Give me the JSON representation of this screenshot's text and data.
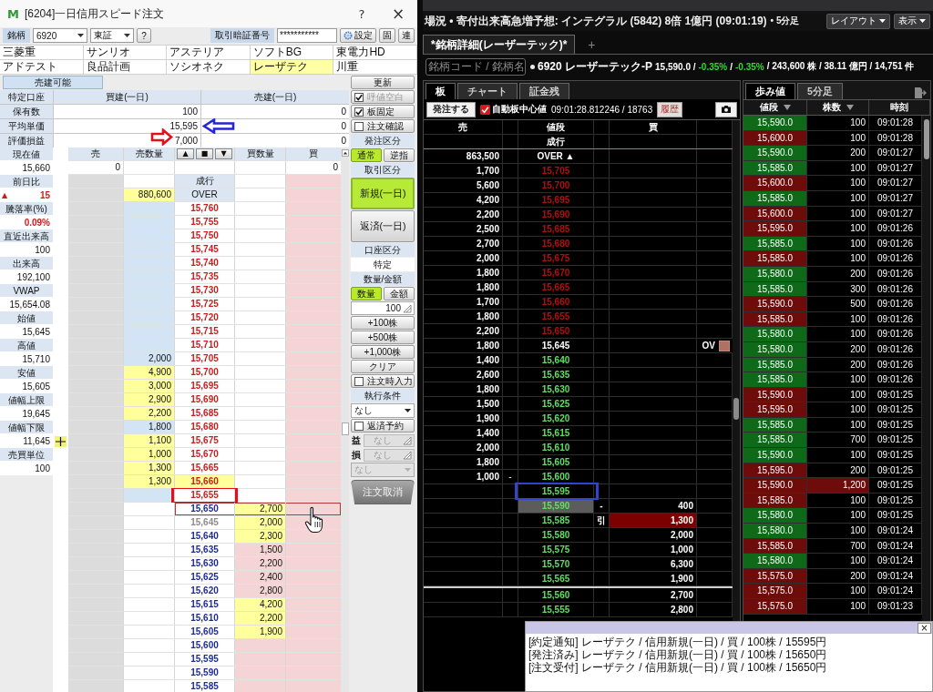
{
  "left_window": {
    "logo": "M",
    "title": "[6204]一日信用スピード注文",
    "title_buttons": [
      {
        "kind": "help",
        "label": "?"
      },
      {
        "kind": "close",
        "label": "×"
      }
    ],
    "symbol_label": "銘柄",
    "symbol_code": "6920",
    "market": "東証",
    "symbol_help": "?",
    "pin_label": "取引暗証番号",
    "pin_value": "***********",
    "tool_buttons": [
      {
        "kind": "settings",
        "label": "設定"
      },
      {
        "kind": "plain",
        "label": "固"
      },
      {
        "kind": "plain",
        "label": "連"
      }
    ],
    "favorites": [
      {
        "label": "三菱重",
        "selected": false
      },
      {
        "label": "サンリオ",
        "selected": false
      },
      {
        "label": "アステリア",
        "selected": false
      },
      {
        "label": "ソフトBG",
        "selected": false
      },
      {
        "label": "東電力HD",
        "selected": false
      },
      {
        "label": "アドテスト",
        "selected": false
      },
      {
        "label": "良品計画",
        "selected": false
      },
      {
        "label": "ソシオネク",
        "selected": false
      },
      {
        "label": "レーザテク",
        "selected": true
      },
      {
        "label": "川重",
        "selected": false
      }
    ],
    "margin_status": "売建可能",
    "position_table": {
      "columns": [
        "特定口座",
        "買建(一日)",
        "売建(一日)"
      ],
      "rows": [
        {
          "kind": "plain",
          "label": "保有数",
          "buy": "100",
          "sell": "0"
        },
        {
          "kind": "arrow_left",
          "label": "平均単価",
          "buy": "15,595",
          "sell": "0"
        },
        {
          "kind": "arrow_right",
          "label": "評価損益",
          "buy": "7,000",
          "sell": "0"
        }
      ]
    },
    "stats": [
      {
        "label": "現在値",
        "value": "15,660"
      },
      {
        "label": "前日比",
        "value": "15",
        "prefix": "▲",
        "color": "#d01818"
      },
      {
        "label": "騰落率(%)",
        "value": "0.09%",
        "color": "#d01818"
      },
      {
        "label": "直近出来高",
        "value": "100"
      },
      {
        "label": "出来高",
        "value": "192,100"
      },
      {
        "label": "VWAP",
        "value": "15,654.08"
      },
      {
        "label": "始値",
        "value": "15,645"
      },
      {
        "label": "高値",
        "value": "15,710"
      },
      {
        "label": "安値",
        "value": "15,605"
      },
      {
        "label": "値幅上限",
        "value": "19,645"
      },
      {
        "label": "値幅下限",
        "value": "11,645",
        "marker": true
      },
      {
        "label": "売買単位",
        "value": "100"
      }
    ],
    "ladder": {
      "headers": {
        "sell": "売",
        "sell_qty": "売数量",
        "buy_qty": "買数量",
        "buy": "買"
      },
      "nav_buttons": [
        "▲",
        "■",
        "▼"
      ],
      "totals": {
        "sell": "0",
        "buy": "0"
      },
      "market_label": "成行",
      "over": {
        "label": "OVER",
        "sell_qty": "880,600",
        "flash": true
      },
      "rows": [
        {
          "price": "15,760",
          "color": "#c81e1e",
          "ask": true
        },
        {
          "price": "15,755",
          "color": "#c81e1e",
          "ask": true
        },
        {
          "price": "15,750",
          "color": "#c81e1e",
          "ask": true
        },
        {
          "price": "15,745",
          "color": "#c81e1e",
          "ask": true
        },
        {
          "price": "15,740",
          "color": "#c81e1e",
          "ask": true
        },
        {
          "price": "15,735",
          "color": "#c81e1e",
          "ask": true
        },
        {
          "price": "15,730",
          "color": "#c81e1e",
          "ask": true
        },
        {
          "price": "15,725",
          "color": "#c81e1e",
          "ask": true
        },
        {
          "price": "15,720",
          "color": "#c81e1e",
          "ask": true
        },
        {
          "price": "15,715",
          "color": "#c81e1e",
          "ask": true
        },
        {
          "price": "15,710",
          "color": "#c81e1e",
          "ask": true
        },
        {
          "price": "15,705",
          "color": "#c81e1e",
          "ask": true,
          "sell_qty": "2,000",
          "flash": false
        },
        {
          "price": "15,700",
          "color": "#c81e1e",
          "ask": true,
          "sell_qty": "4,900",
          "flash": true
        },
        {
          "price": "15,695",
          "color": "#c81e1e",
          "ask": true,
          "sell_qty": "3,000",
          "flash": true
        },
        {
          "price": "15,690",
          "color": "#c81e1e",
          "ask": true,
          "sell_qty": "2,900",
          "flash": true
        },
        {
          "price": "15,685",
          "color": "#c81e1e",
          "ask": true,
          "sell_qty": "2,200",
          "flash": true
        },
        {
          "price": "15,680",
          "color": "#c81e1e",
          "ask": true,
          "sell_qty": "1,800",
          "flash": false
        },
        {
          "price": "15,675",
          "color": "#c81e1e",
          "ask": true,
          "sell_qty": "1,100",
          "flash": true
        },
        {
          "price": "15,670",
          "color": "#c81e1e",
          "ask": true,
          "sell_qty": "1,000",
          "flash": true
        },
        {
          "price": "15,665",
          "color": "#c81e1e",
          "ask": true,
          "sell_qty": "1,300",
          "flash": true
        },
        {
          "price": "15,660",
          "color": "#c81e1e",
          "ask": true,
          "sell_qty": "1,300",
          "flash": true,
          "current": true
        },
        {
          "price": "15,655",
          "color": "#c81e1e",
          "ask": true,
          "marked": true
        },
        {
          "price": "15,650",
          "color": "#1e2c9a",
          "ask": false,
          "buy_qty": "2,700",
          "flash": true,
          "hover": true
        },
        {
          "price": "15,645",
          "color": "#8c8c8c",
          "ask": false,
          "buy_qty": "2,000",
          "flash": true
        },
        {
          "price": "15,640",
          "color": "#1e2c9a",
          "ask": false,
          "buy_qty": "2,300",
          "flash": true
        },
        {
          "price": "15,635",
          "color": "#1e2c9a",
          "ask": false,
          "buy_qty": "1,500",
          "flash": false
        },
        {
          "price": "15,630",
          "color": "#1e2c9a",
          "ask": false,
          "buy_qty": "2,200",
          "flash": false
        },
        {
          "price": "15,625",
          "color": "#1e2c9a",
          "ask": false,
          "buy_qty": "2,400",
          "flash": false
        },
        {
          "price": "15,620",
          "color": "#1e2c9a",
          "ask": false,
          "buy_qty": "2,800",
          "flash": false
        },
        {
          "price": "15,615",
          "color": "#1e2c9a",
          "ask": false,
          "buy_qty": "4,200",
          "flash": true
        },
        {
          "price": "15,610",
          "color": "#1e2c9a",
          "ask": false,
          "buy_qty": "2,200",
          "flash": true
        },
        {
          "price": "15,605",
          "color": "#1e2c9a",
          "ask": false,
          "buy_qty": "1,900",
          "flash": true
        },
        {
          "price": "15,600",
          "color": "#1e2c9a",
          "ask": false
        },
        {
          "price": "15,595",
          "color": "#1e2c9a",
          "ask": false
        },
        {
          "price": "15,590",
          "color": "#1e2c9a",
          "ask": false
        },
        {
          "price": "15,585",
          "color": "#1e2c9a",
          "ask": false
        }
      ]
    },
    "side_panel": [
      {
        "kind": "button",
        "label": "更新"
      },
      {
        "kind": "checkbox",
        "label": "呼値空白",
        "checked": true,
        "disabled": true
      },
      {
        "kind": "checkbox",
        "label": "板固定",
        "checked": true,
        "disabled": false
      },
      {
        "kind": "checkbox",
        "label": "注文確認",
        "checked": false,
        "disabled": false
      },
      {
        "kind": "heading",
        "label": "発注区分"
      },
      {
        "kind": "segmented",
        "options": [
          {
            "label": "通常",
            "selected": true
          },
          {
            "label": "逆指",
            "selected": false
          }
        ]
      },
      {
        "kind": "heading",
        "label": "取引区分"
      },
      {
        "kind": "action",
        "label": "新規(一日)",
        "selected": true
      },
      {
        "kind": "action",
        "label": "返済(一日)",
        "selected": false
      },
      {
        "kind": "heading",
        "label": "口座区分"
      },
      {
        "kind": "value",
        "label": "特定"
      },
      {
        "kind": "heading",
        "label": "数量/金額"
      },
      {
        "kind": "segmented",
        "options": [
          {
            "label": "数量",
            "selected": true
          },
          {
            "label": "金額",
            "selected": false
          }
        ]
      },
      {
        "kind": "input",
        "value": "100"
      },
      {
        "kind": "button",
        "label": "+100株"
      },
      {
        "kind": "button",
        "label": "+500株"
      },
      {
        "kind": "button",
        "label": "+1,000株"
      },
      {
        "kind": "button",
        "label": "クリア"
      },
      {
        "kind": "checkbox",
        "label": "注文時入力",
        "checked": false,
        "disabled": false
      },
      {
        "kind": "heading",
        "label": "執行条件"
      },
      {
        "kind": "select",
        "value": "なし",
        "disabled": false
      },
      {
        "kind": "checkbox",
        "label": "返済予約",
        "checked": false,
        "disabled": false
      },
      {
        "kind": "prefixed",
        "prefix": "益",
        "value": "なし",
        "disabled": true
      },
      {
        "kind": "prefixed",
        "prefix": "損",
        "value": "なし",
        "disabled": true
      },
      {
        "kind": "select",
        "value": "なし",
        "disabled": true
      },
      {
        "kind": "cancel",
        "label": "注文取消"
      }
    ]
  },
  "app": {
    "toolbar": {
      "ticker": "場況 • 寄付出来高急増予想: インテグラル (5842) 8倍 1億円 (09:01:19)",
      "ticker_extra": "• 5分足",
      "menus": [
        "レイアウト",
        "表示"
      ]
    },
    "tabs": [
      {
        "label": "*銘柄詳細(レーザーテック)*",
        "selected": true
      }
    ],
    "add_tab": "+",
    "quote": {
      "search_placeholder": "銘柄コード / 銘柄名",
      "segments": [
        {
          "text": "6920 レーザーテック-P"
        },
        {
          "text": "15,590.0 /"
        },
        {
          "text": "-0.35%",
          "color": "#2fd82f"
        },
        {
          "text": "/"
        },
        {
          "text": "-0.35%",
          "color": "#2fd82f"
        },
        {
          "text": "/ 243,600 株 / 38.11 億円 / 14,751 件"
        }
      ]
    },
    "board": {
      "tabs": [
        {
          "label": "板",
          "selected": true
        },
        {
          "label": "チャート",
          "selected": false
        },
        {
          "label": "証金残",
          "selected": false
        }
      ],
      "order_button": "発注する",
      "auto_center": {
        "label": "自動板中心値",
        "checked": true
      },
      "timestamp": "09:01:28.812246 / 18763",
      "history_button": "履歴",
      "columns": {
        "sell": "売",
        "price": "値段",
        "buy": "買"
      },
      "market_label": "成行",
      "rows": [
        {
          "sell": "863,500",
          "price": "OVER ▲",
          "color": "#ffffff"
        },
        {
          "sell": "1,700",
          "price": "15,705",
          "color": "#b40f0f"
        },
        {
          "sell": "5,600",
          "price": "15,700",
          "color": "#b40f0f"
        },
        {
          "sell": "4,200",
          "price": "15,695",
          "color": "#b40f0f"
        },
        {
          "sell": "2,200",
          "price": "15,690",
          "color": "#b40f0f"
        },
        {
          "sell": "2,500",
          "price": "15,685",
          "color": "#b40f0f"
        },
        {
          "sell": "2,700",
          "price": "15,680",
          "color": "#b40f0f"
        },
        {
          "sell": "2,000",
          "price": "15,675",
          "color": "#b40f0f"
        },
        {
          "sell": "1,800",
          "price": "15,670",
          "color": "#b40f0f"
        },
        {
          "sell": "1,800",
          "price": "15,665",
          "color": "#b40f0f"
        },
        {
          "sell": "1,700",
          "price": "15,660",
          "color": "#b40f0f"
        },
        {
          "sell": "1,800",
          "price": "15,655",
          "color": "#b40f0f"
        },
        {
          "sell": "2,200",
          "price": "15,650",
          "color": "#b40f0f"
        },
        {
          "sell": "1,800",
          "price": "15,645",
          "color": "#ffffff",
          "flag": "OV"
        },
        {
          "sell": "1,400",
          "price": "15,640",
          "color": "#5fe05f"
        },
        {
          "sell": "2,600",
          "price": "15,635",
          "color": "#5fe05f"
        },
        {
          "sell": "1,800",
          "price": "15,630",
          "color": "#5fe05f"
        },
        {
          "sell": "1,500",
          "price": "15,625",
          "color": "#5fe05f"
        },
        {
          "sell": "1,900",
          "price": "15,620",
          "color": "#5fe05f"
        },
        {
          "sell": "1,400",
          "price": "15,615",
          "color": "#5fe05f"
        },
        {
          "sell": "2,000",
          "price": "15,610",
          "color": "#5fe05f"
        },
        {
          "sell": "1,800",
          "price": "15,605",
          "color": "#5fe05f"
        },
        {
          "sell": "1,000",
          "sell_note": "-",
          "price": "15,600",
          "color": "#5fe05f"
        },
        {
          "price": "15,595",
          "color": "#5fe05f",
          "marked": true
        },
        {
          "price": "15,590",
          "color": "#5fe05f",
          "shaded": true,
          "buy_note": "-",
          "buy": "400"
        },
        {
          "price": "15,585",
          "color": "#5fe05f",
          "buy_note": "引",
          "buy": "1,300",
          "alert": true
        },
        {
          "price": "15,580",
          "color": "#5fe05f",
          "buy": "2,000"
        },
        {
          "price": "15,575",
          "color": "#5fe05f",
          "buy": "1,000"
        },
        {
          "price": "15,570",
          "color": "#5fe05f",
          "buy": "6,300"
        },
        {
          "price": "15,565",
          "color": "#5fe05f",
          "buy": "1,900",
          "divider": true
        },
        {
          "price": "15,560",
          "color": "#5fe05f",
          "buy": "2,700"
        },
        {
          "price": "15,555",
          "color": "#5fe05f",
          "buy": "2,800"
        }
      ]
    },
    "ticks": {
      "tabs": [
        {
          "label": "歩み値",
          "selected": true
        },
        {
          "label": "5分足",
          "selected": false
        }
      ],
      "columns": [
        {
          "label": "値段",
          "filter": true
        },
        {
          "label": "株数",
          "filter": true
        },
        {
          "label": "時刻",
          "filter": false
        }
      ],
      "rows": [
        {
          "price": "15,590.0",
          "color": "#0e6a18",
          "qty": "100",
          "time": "09:01:28"
        },
        {
          "price": "15,600.0",
          "color": "#6e0b0b",
          "qty": "100",
          "time": "09:01:28"
        },
        {
          "price": "15,590.0",
          "color": "#0e6a18",
          "qty": "200",
          "time": "09:01:27"
        },
        {
          "price": "15,585.0",
          "color": "#0e6a18",
          "qty": "100",
          "time": "09:01:27"
        },
        {
          "price": "15,600.0",
          "color": "#6e0b0b",
          "qty": "100",
          "time": "09:01:27"
        },
        {
          "price": "15,585.0",
          "color": "#0e6a18",
          "qty": "100",
          "time": "09:01:27"
        },
        {
          "price": "15,600.0",
          "color": "#6e0b0b",
          "qty": "100",
          "time": "09:01:27"
        },
        {
          "price": "15,595.0",
          "color": "#6e0b0b",
          "qty": "100",
          "time": "09:01:26"
        },
        {
          "price": "15,585.0",
          "color": "#0e6a18",
          "qty": "100",
          "time": "09:01:26"
        },
        {
          "price": "15,585.0",
          "color": "#6e0b0b",
          "qty": "100",
          "time": "09:01:26"
        },
        {
          "price": "15,580.0",
          "color": "#0e6a18",
          "qty": "200",
          "time": "09:01:26"
        },
        {
          "price": "15,585.0",
          "color": "#0e6a18",
          "qty": "300",
          "time": "09:01:26"
        },
        {
          "price": "15,590.0",
          "color": "#6e0b0b",
          "qty": "500",
          "time": "09:01:26"
        },
        {
          "price": "15,585.0",
          "color": "#6e0b0b",
          "qty": "100",
          "time": "09:01:26"
        },
        {
          "price": "15,580.0",
          "color": "#0e6a18",
          "qty": "100",
          "time": "09:01:26"
        },
        {
          "price": "15,580.0",
          "color": "#0e6a18",
          "qty": "200",
          "time": "09:01:26"
        },
        {
          "price": "15,585.0",
          "color": "#0e6a18",
          "qty": "200",
          "time": "09:01:26"
        },
        {
          "price": "15,585.0",
          "color": "#0e6a18",
          "qty": "100",
          "time": "09:01:26"
        },
        {
          "price": "15,590.0",
          "color": "#6e0b0b",
          "qty": "100",
          "time": "09:01:25"
        },
        {
          "price": "15,595.0",
          "color": "#6e0b0b",
          "qty": "100",
          "time": "09:01:25"
        },
        {
          "price": "15,585.0",
          "color": "#0e6a18",
          "qty": "100",
          "time": "09:01:25"
        },
        {
          "price": "15,585.0",
          "color": "#0e6a18",
          "qty": "700",
          "time": "09:01:25"
        },
        {
          "price": "15,590.0",
          "color": "#0e6a18",
          "qty": "100",
          "time": "09:01:25"
        },
        {
          "price": "15,595.0",
          "color": "#6e0b0b",
          "qty": "200",
          "time": "09:01:25"
        },
        {
          "price": "15,590.0",
          "color": "#6e0b0b",
          "qty": "1,200",
          "time": "09:01:25",
          "large": true
        },
        {
          "price": "15,585.0",
          "color": "#6e0b0b",
          "qty": "100",
          "time": "09:01:25"
        },
        {
          "price": "15,580.0",
          "color": "#0e6a18",
          "qty": "100",
          "time": "09:01:25"
        },
        {
          "price": "15,580.0",
          "color": "#0e6a18",
          "qty": "100",
          "time": "09:01:24"
        },
        {
          "price": "15,585.0",
          "color": "#6e0b0b",
          "qty": "700",
          "time": "09:01:24"
        },
        {
          "price": "15,580.0",
          "color": "#0e6a18",
          "qty": "100",
          "time": "09:01:24"
        },
        {
          "price": "15,575.0",
          "color": "#6e0b0b",
          "qty": "200",
          "time": "09:01:24"
        },
        {
          "price": "15,575.0",
          "color": "#6e0b0b",
          "qty": "100",
          "time": "09:01:24"
        },
        {
          "price": "15,575.0",
          "color": "#6e0b0b",
          "qty": "100",
          "time": "09:01:23"
        }
      ]
    },
    "notifications": {
      "close": "×",
      "lines": [
        "[約定通知] レーザテク / 信用新規(一日) / 買 / 100株 / 15595円",
        "[発注済み] レーザテク / 信用新規(一日) / 買 / 100株 / 15650円",
        "[注文受付] レーザテク / 信用新規(一日) / 買 / 100株 / 15650円"
      ]
    }
  }
}
